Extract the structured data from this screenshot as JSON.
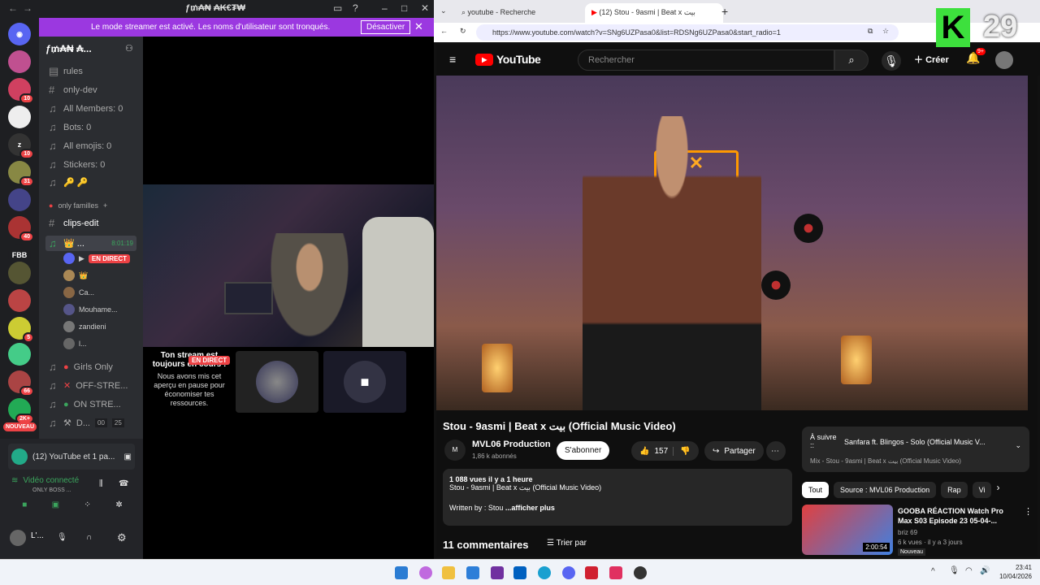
{
  "discord": {
    "window_title": "ƒ₥₳₦ ₳₭€₮₩",
    "servers": [
      "discord",
      "10",
      "z",
      "10",
      "31",
      "40",
      "FBB",
      "5",
      "66",
      "2K+",
      "NOUVEAU"
    ],
    "banner": {
      "message": "Le mode streamer est activé. Les noms d'utilisateur sont tronqués.",
      "button": "Désactiver"
    },
    "server_name": "ƒ₥₳₦ ₳...",
    "channels": [
      "rules",
      "only-dev",
      "All Members: 0",
      "Bots: 0",
      "All emojis: 0",
      "Stickers: 0",
      "🔑 🔑"
    ],
    "category": "only familles",
    "clips_channel": "clips-edit",
    "voice_channel": "👑 ...",
    "voice_time": "8:01:19",
    "live_badge": "EN DIRECT",
    "voice_users": [
      "Ca...",
      "Mouhame...",
      "zandieni",
      "l..."
    ],
    "more_channels": [
      "Girls Only",
      "OFF-STRE...",
      "ON STRE...",
      "D..."
    ],
    "more_counts": [
      "00",
      "25"
    ],
    "paused_title": "Ton stream est toujours en cours !",
    "paused_text": "Nous avons mis cet aperçu en pause pour économiser tes ressources.",
    "activity": "(12) YouTube et 1 pa...",
    "voice_status": "Vidéo connecté",
    "voice_sub": "ONLY BOSS ...",
    "user": "L'..."
  },
  "chrome": {
    "tab1": "youtube - Recherche",
    "tab2": "(12) Stou - 9asmi | Beat x بيت",
    "url": "https://www.youtube.com/watch?v=SNg6UZPasa0&list=RDSNg6UZPasa0&start_radio=1"
  },
  "youtube": {
    "logo": "YouTube",
    "search_placeholder": "Rechercher",
    "create": "Créer",
    "notif_count": "9+",
    "title": "Stou - 9asmi | Beat x بيت (Official Music Video)",
    "channel": "MVL06 Production",
    "subs": "1,86 k abonnés",
    "subscribe": "S'abonner",
    "likes": "157",
    "share": "Partager",
    "views": "1 088 vues  il y a 1 heure",
    "desc_line": "Stou - 9asmi | Beat x بيت (Official Music Video)",
    "written": "Written by : Stou",
    "more": "...afficher plus",
    "comments": "11 commentaires",
    "sort": "Trier par",
    "next_label": "À suivre ::",
    "next_title": "Sanfara ft. Blingos - Solo (Official Music V...",
    "next_sub": "Mix - Stou - 9asmi | Beat x بيت (Official Music Video)",
    "chips": [
      "Tout",
      "Source : MVL06 Production",
      "Rap",
      "Vi"
    ],
    "rec_title": "GOOBA RÉACTION Watch Pro Max S03 Episode 23 05-04-...",
    "rec_channel": "briz 69",
    "rec_meta": "6 k vues · il y a 3 jours",
    "rec_badge": "Nouveau",
    "rec_duration": "2:00:54"
  },
  "overlay": {
    "letter": "K",
    "number": "29"
  },
  "taskbar": {
    "time": "23:41",
    "date": "10/04/2026"
  }
}
